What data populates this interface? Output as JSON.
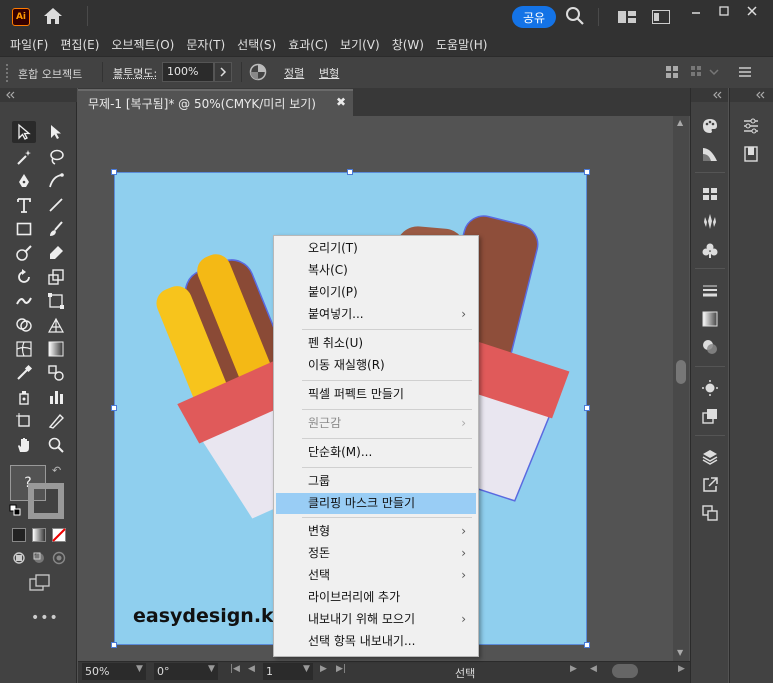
{
  "app": {
    "logo_text": "Ai"
  },
  "titlebar": {
    "share_label": "공유"
  },
  "menubar": {
    "items": [
      "파일(F)",
      "편집(E)",
      "오브젝트(O)",
      "문자(T)",
      "선택(S)",
      "효과(C)",
      "보기(V)",
      "창(W)",
      "도움말(H)"
    ]
  },
  "controlbar": {
    "object_label": "혼합 오브젝트",
    "opacity_label": "불투명도:",
    "opacity_value": "100%",
    "align_label": "정렬",
    "transform_label": "변형"
  },
  "document": {
    "tab_title": "무제-1 [복구됨]* @ 50%(CMYK/미리 보기)",
    "close_glyph": "✖"
  },
  "artwork": {
    "watermark": "easydesign.kr",
    "background_color": "#8fcfee"
  },
  "statusbar": {
    "zoom": "50%",
    "rotation": "0°",
    "page": "1",
    "status_text": "선택"
  },
  "context_menu": {
    "items": [
      {
        "label": "오리기(T)",
        "enabled": true,
        "submenu": false
      },
      {
        "label": "복사(C)",
        "enabled": true,
        "submenu": false
      },
      {
        "label": "붙이기(P)",
        "enabled": true,
        "submenu": false
      },
      {
        "label": "붙여넣기...",
        "enabled": true,
        "submenu": true
      },
      {
        "label": "펜 취소(U)",
        "enabled": true,
        "submenu": false
      },
      {
        "label": "이동 재실행(R)",
        "enabled": true,
        "submenu": false
      },
      {
        "label": "픽셀 퍼펙트 만들기",
        "enabled": true,
        "submenu": false
      },
      {
        "label": "원근감",
        "enabled": false,
        "submenu": true
      },
      {
        "label": "단순화(M)...",
        "enabled": true,
        "submenu": false
      },
      {
        "label": "그룹",
        "enabled": true,
        "submenu": false
      },
      {
        "label": "클리핑 마스크 만들기",
        "enabled": true,
        "submenu": false,
        "highlighted": true
      },
      {
        "label": "변형",
        "enabled": true,
        "submenu": true
      },
      {
        "label": "정돈",
        "enabled": true,
        "submenu": true
      },
      {
        "label": "선택",
        "enabled": true,
        "submenu": true
      },
      {
        "label": "라이브러리에 추가",
        "enabled": true,
        "submenu": false
      },
      {
        "label": "내보내기 위해 모으기",
        "enabled": true,
        "submenu": true
      },
      {
        "label": "선택 항목 내보내기...",
        "enabled": true,
        "submenu": false
      }
    ]
  },
  "colors": {
    "accent": "#1473e6",
    "highlight": "#99cdf5",
    "artboard": "#8fcfee",
    "chrome_dark": "#323232"
  }
}
